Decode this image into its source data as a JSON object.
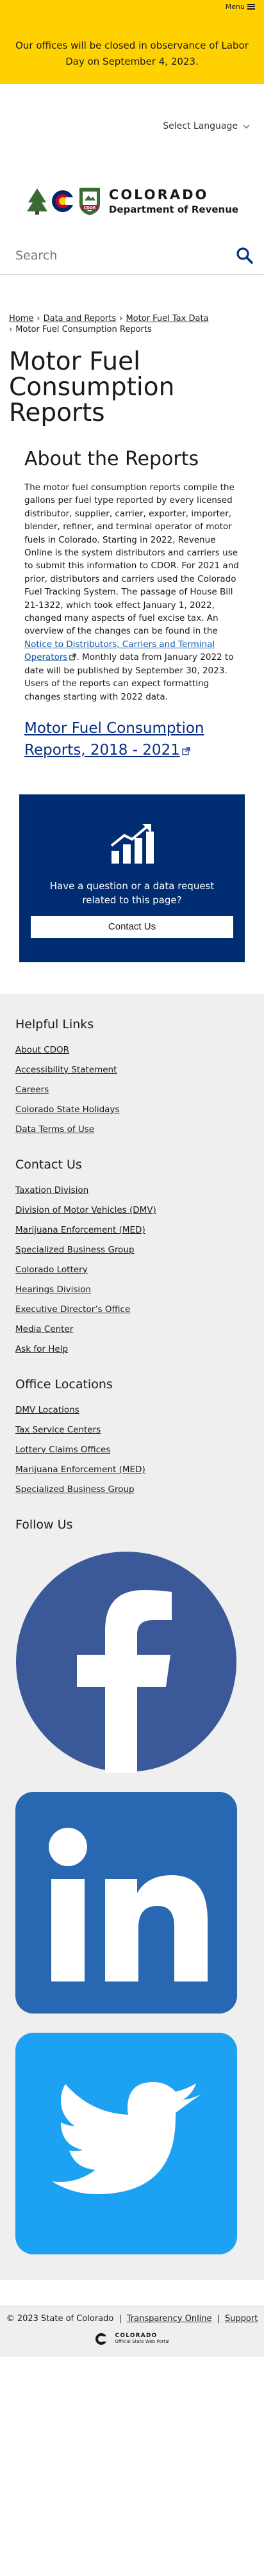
{
  "topbar": {
    "menu_label": "Menu"
  },
  "alert": {
    "text": "Our offices will be closed in observance of Labor Day on September 4, 2023."
  },
  "language": {
    "label": "Select Language"
  },
  "logo": {
    "line1": "COLORADO",
    "line2": "Department of Revenue",
    "badge_text": "CDOR"
  },
  "search": {
    "placeholder": "Search"
  },
  "breadcrumb": {
    "home": "Home",
    "data_reports": "Data and Reports",
    "motor_fuel_tax_data": "Motor Fuel Tax Data",
    "current": "Motor Fuel Consumption Reports",
    "sep": "›"
  },
  "page_title": "Motor Fuel Consumption Reports",
  "about": {
    "heading": "About the Reports",
    "body_1": "The motor fuel consumption reports compile the gallons per fuel type reported by every licensed distributor, supplier, carrier, exporter, importer, blender, refiner, and terminal operator of motor fuels in Colorado. Starting in 2022, Revenue Online is the system distributors and carriers use to submit this information to CDOR. For 2021 and prior, distributors and carriers used the Colorado Fuel Tracking System. The passage of House Bill 21-1322, which took effect January 1, 2022, changed many aspects of fuel excise tax. An overview of the changes can be found in the ",
    "notice_link": "Notice to Distributors, Carriers and Terminal Operators",
    "body_2": ". Monthly data from January 2022 to date will be published by September 30, 2023. Users of the reports can expect formatting changes starting with 2022 data.",
    "report_link": "Motor Fuel Consumption Reports, 2018 - 2021"
  },
  "cta": {
    "question": "Have a question or a data request related to this page?",
    "button": "Contact Us"
  },
  "footer": {
    "helpful_links": {
      "heading": "Helpful Links",
      "items": [
        "About CDOR",
        "Accessibility Statement",
        "Careers",
        "Colorado State Holidays",
        "Data Terms of Use"
      ]
    },
    "contact_us": {
      "heading": "Contact Us",
      "items": [
        "Taxation Division",
        "Division of Motor Vehicles (DMV)",
        "Marijuana Enforcement (MED)",
        "Specialized Business Group",
        "Colorado Lottery",
        "Hearings Division",
        "Executive Director’s Office",
        "Media Center",
        "Ask for Help"
      ]
    },
    "office_locations": {
      "heading": "Office Locations",
      "items": [
        "DMV Locations",
        "Tax Service Centers",
        "Lottery Claims Offices",
        "Marijuana Enforcement (MED)",
        "Specialized Business Group"
      ]
    },
    "follow_us": {
      "heading": "Follow Us"
    }
  },
  "bottom": {
    "copyright": "© 2023 State of Colorado",
    "transparency": "Transparency Online",
    "support": "Support",
    "divider": "|",
    "portal_line1": "COLORADO",
    "portal_line2": "Official State Web Portal"
  },
  "colors": {
    "alert_yellow": "#ffd100",
    "cta_navy": "#002d72",
    "facebook_blue": "#3b5998",
    "linkedin_blue": "#2867b2",
    "twitter_blue": "#1da1f2",
    "link_blue": "#0a56a8"
  },
  "icons": [
    "hamburger-icon",
    "chevron-down-icon",
    "search-icon",
    "external-link-icon",
    "chart-growth-icon",
    "facebook-icon",
    "linkedin-icon",
    "twitter-icon"
  ]
}
